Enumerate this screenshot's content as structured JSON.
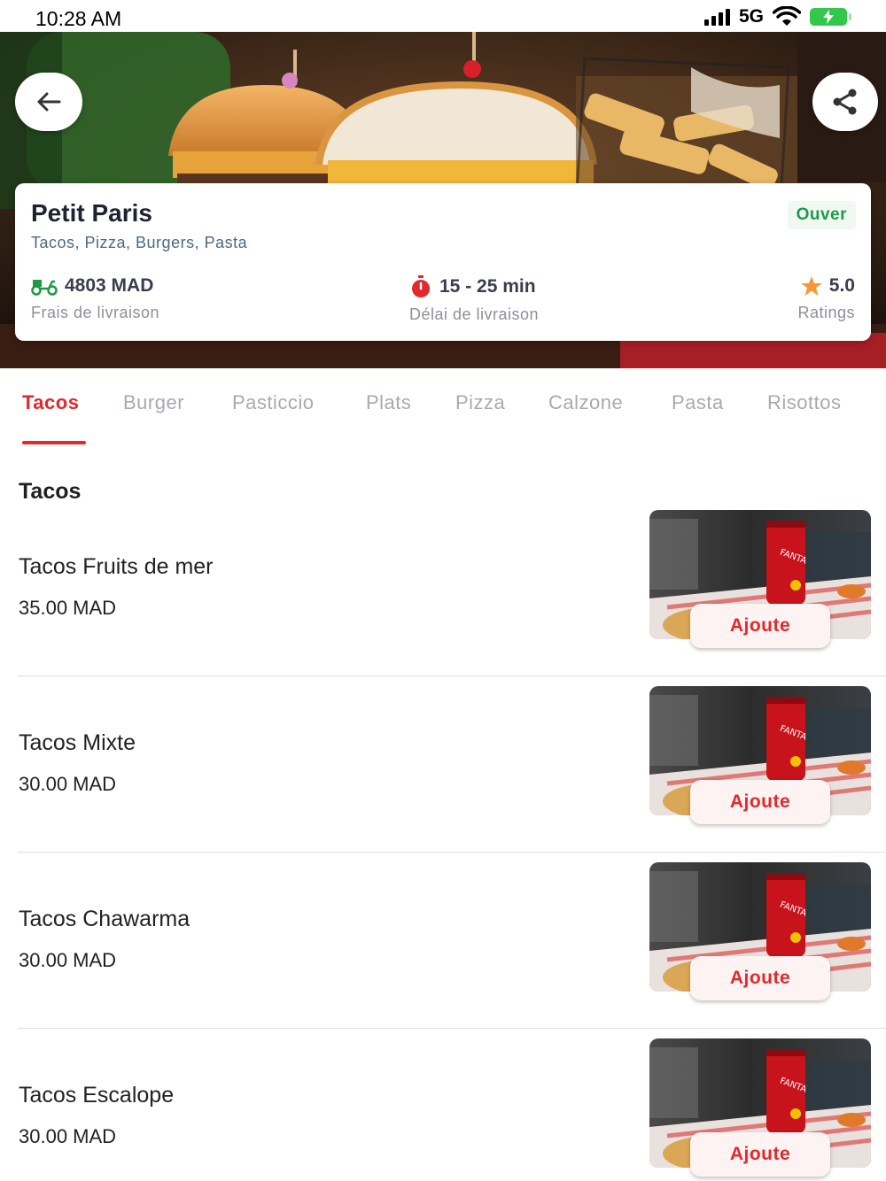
{
  "status_bar": {
    "time": "10:28 AM",
    "network": "5G"
  },
  "restaurant": {
    "name": "Petit Paris",
    "categories": "Tacos, Pizza, Burgers, Pasta",
    "status": "Ouver",
    "delivery_fee": {
      "value": "4803 MAD",
      "label": "Frais de livraison"
    },
    "delivery_time": {
      "value": "15 - 25 min",
      "label": "Délai de livraison"
    },
    "rating": {
      "value": "5.0",
      "label": "Ratings"
    }
  },
  "tabs": [
    {
      "label": "Tacos",
      "active": true
    },
    {
      "label": "Burger",
      "active": false
    },
    {
      "label": "Pasticcio",
      "active": false
    },
    {
      "label": "Plats",
      "active": false
    },
    {
      "label": "Pizza",
      "active": false
    },
    {
      "label": "Calzone",
      "active": false
    },
    {
      "label": "Pasta",
      "active": false
    },
    {
      "label": "Risottos",
      "active": false
    }
  ],
  "section": {
    "title": "Tacos"
  },
  "items": [
    {
      "name": "Tacos Fruits de mer",
      "price": "35.00 MAD",
      "add_label": "Ajoute"
    },
    {
      "name": "Tacos Mixte",
      "price": "30.00 MAD",
      "add_label": "Ajoute"
    },
    {
      "name": "Tacos Chawarma",
      "price": "30.00 MAD",
      "add_label": "Ajoute"
    },
    {
      "name": "Tacos Escalope",
      "price": "30.00 MAD",
      "add_label": "Ajoute"
    }
  ],
  "colors": {
    "accent": "#e2292b",
    "open": "#1e9b45",
    "star": "#f29a33"
  },
  "icons": {
    "back": "arrow-left-icon",
    "share": "share-icon",
    "delivery": "scooter-icon",
    "timer": "stopwatch-icon",
    "rating": "star-icon"
  }
}
